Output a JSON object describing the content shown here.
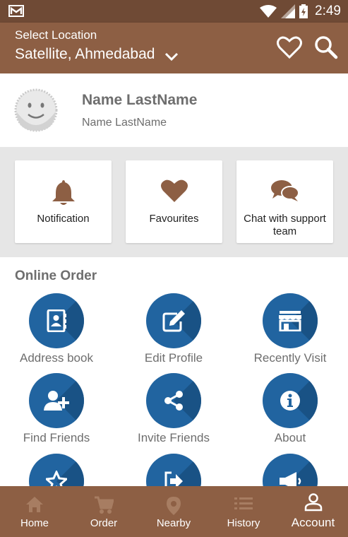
{
  "status_bar": {
    "time": "2:49"
  },
  "header": {
    "select_label": "Select Location",
    "location": "Satellite, Ahmedabad"
  },
  "profile": {
    "name": "Name LastName",
    "subtitle": "Name LastName"
  },
  "quick_actions": [
    {
      "label": "Notification",
      "icon": "bell-icon"
    },
    {
      "label": "Favourites",
      "icon": "heart-icon"
    },
    {
      "label": "Chat with support team",
      "icon": "chat-icon"
    }
  ],
  "online_order": {
    "title": "Online Order",
    "items": [
      {
        "label": "Address book",
        "icon": "address-book-icon"
      },
      {
        "label": "Edit Profile",
        "icon": "edit-icon"
      },
      {
        "label": "Recently Visit",
        "icon": "store-icon"
      },
      {
        "label": "Find Friends",
        "icon": "add-user-icon"
      },
      {
        "label": "Invite Friends",
        "icon": "share-icon"
      },
      {
        "label": "About",
        "icon": "info-icon"
      },
      {
        "label": "",
        "icon": "star-icon"
      },
      {
        "label": "",
        "icon": "logout-icon"
      },
      {
        "label": "",
        "icon": "megaphone-icon"
      }
    ]
  },
  "bottom_nav": [
    {
      "label": "Home",
      "icon": "home-icon",
      "active": false
    },
    {
      "label": "Order",
      "icon": "cart-icon",
      "active": false
    },
    {
      "label": "Nearby",
      "icon": "location-pin-icon",
      "active": false
    },
    {
      "label": "History",
      "icon": "list-icon",
      "active": false
    },
    {
      "label": "Account",
      "icon": "person-icon",
      "active": true
    }
  ],
  "colors": {
    "primary": "#8d5f44",
    "primary_dark": "#6f4a35",
    "accent": "#2164a0",
    "icon_brown": "#8d5f44",
    "nav_inactive": "#a77d62"
  }
}
